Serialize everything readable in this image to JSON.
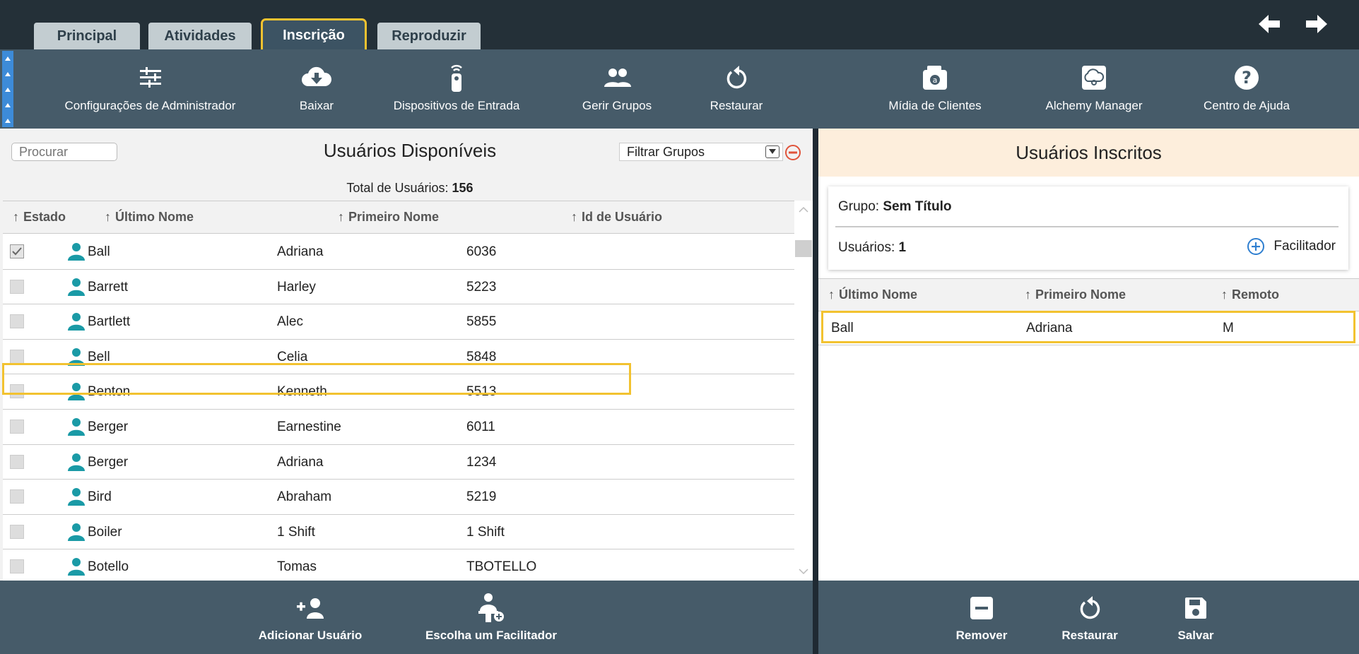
{
  "tabs": [
    {
      "label": "Principal"
    },
    {
      "label": "Atividades"
    },
    {
      "label": "Inscrição"
    },
    {
      "label": "Reproduzir"
    }
  ],
  "toolbar": {
    "admin_config": "Configurações de Administrador",
    "download": "Baixar",
    "input_devices": "Dispositivos de Entrada",
    "manage_groups": "Gerir Grupos",
    "restore": "Restaurar",
    "client_media": "Mídia de Clientes",
    "alchemy_manager": "Alchemy Manager",
    "help_center": "Centro de Ajuda"
  },
  "left": {
    "search_placeholder": "Procurar",
    "title": "Usuários Disponíveis",
    "filter_label": "Filtrar Grupos",
    "total_label": "Total de Usuários:",
    "total_value": "156",
    "columns": {
      "status": "Estado",
      "last_name": "Último Nome",
      "first_name": "Primeiro Nome",
      "user_id": "Id de Usuário"
    },
    "rows": [
      {
        "last": "Ball",
        "first": "Adriana",
        "id": "6036",
        "checked": true
      },
      {
        "last": "Barrett",
        "first": "Harley",
        "id": "5223",
        "checked": false
      },
      {
        "last": "Bartlett",
        "first": "Alec",
        "id": "5855",
        "checked": false
      },
      {
        "last": "Bell",
        "first": "Celia",
        "id": "5848",
        "checked": false
      },
      {
        "last": "Benton",
        "first": "Kenneth",
        "id": "5513",
        "checked": false
      },
      {
        "last": "Berger",
        "first": "Earnestine",
        "id": "6011",
        "checked": false
      },
      {
        "last": "Berger",
        "first": "Adriana",
        "id": "1234",
        "checked": false
      },
      {
        "last": "Bird",
        "first": "Abraham",
        "id": "5219",
        "checked": false
      },
      {
        "last": "Boiler",
        "first": "1 Shift",
        "id": "1 Shift",
        "checked": false
      },
      {
        "last": "Botello",
        "first": "Tomas",
        "id": "TBOTELLO",
        "checked": false
      }
    ],
    "add_user": "Adicionar Usuário",
    "choose_facilitator": "Escolha um Facilitador"
  },
  "right": {
    "title": "Usuários Inscritos",
    "group_label": "Grupo:",
    "group_name": "Sem Título",
    "users_label": "Usuários:",
    "users_count": "1",
    "facilitator": "Facilitador",
    "columns": {
      "last_name": "Último Nome",
      "first_name": "Primeiro Nome",
      "remote": "Remoto"
    },
    "rows": [
      {
        "last": "Ball",
        "first": "Adriana",
        "remote": "M"
      }
    ],
    "remove": "Remover",
    "restore": "Restaurar",
    "save": "Salvar"
  },
  "colors": {
    "accent_highlight": "#f2c230",
    "toolbar_bg": "#465b69",
    "icon_teal": "#1a9aa6"
  }
}
